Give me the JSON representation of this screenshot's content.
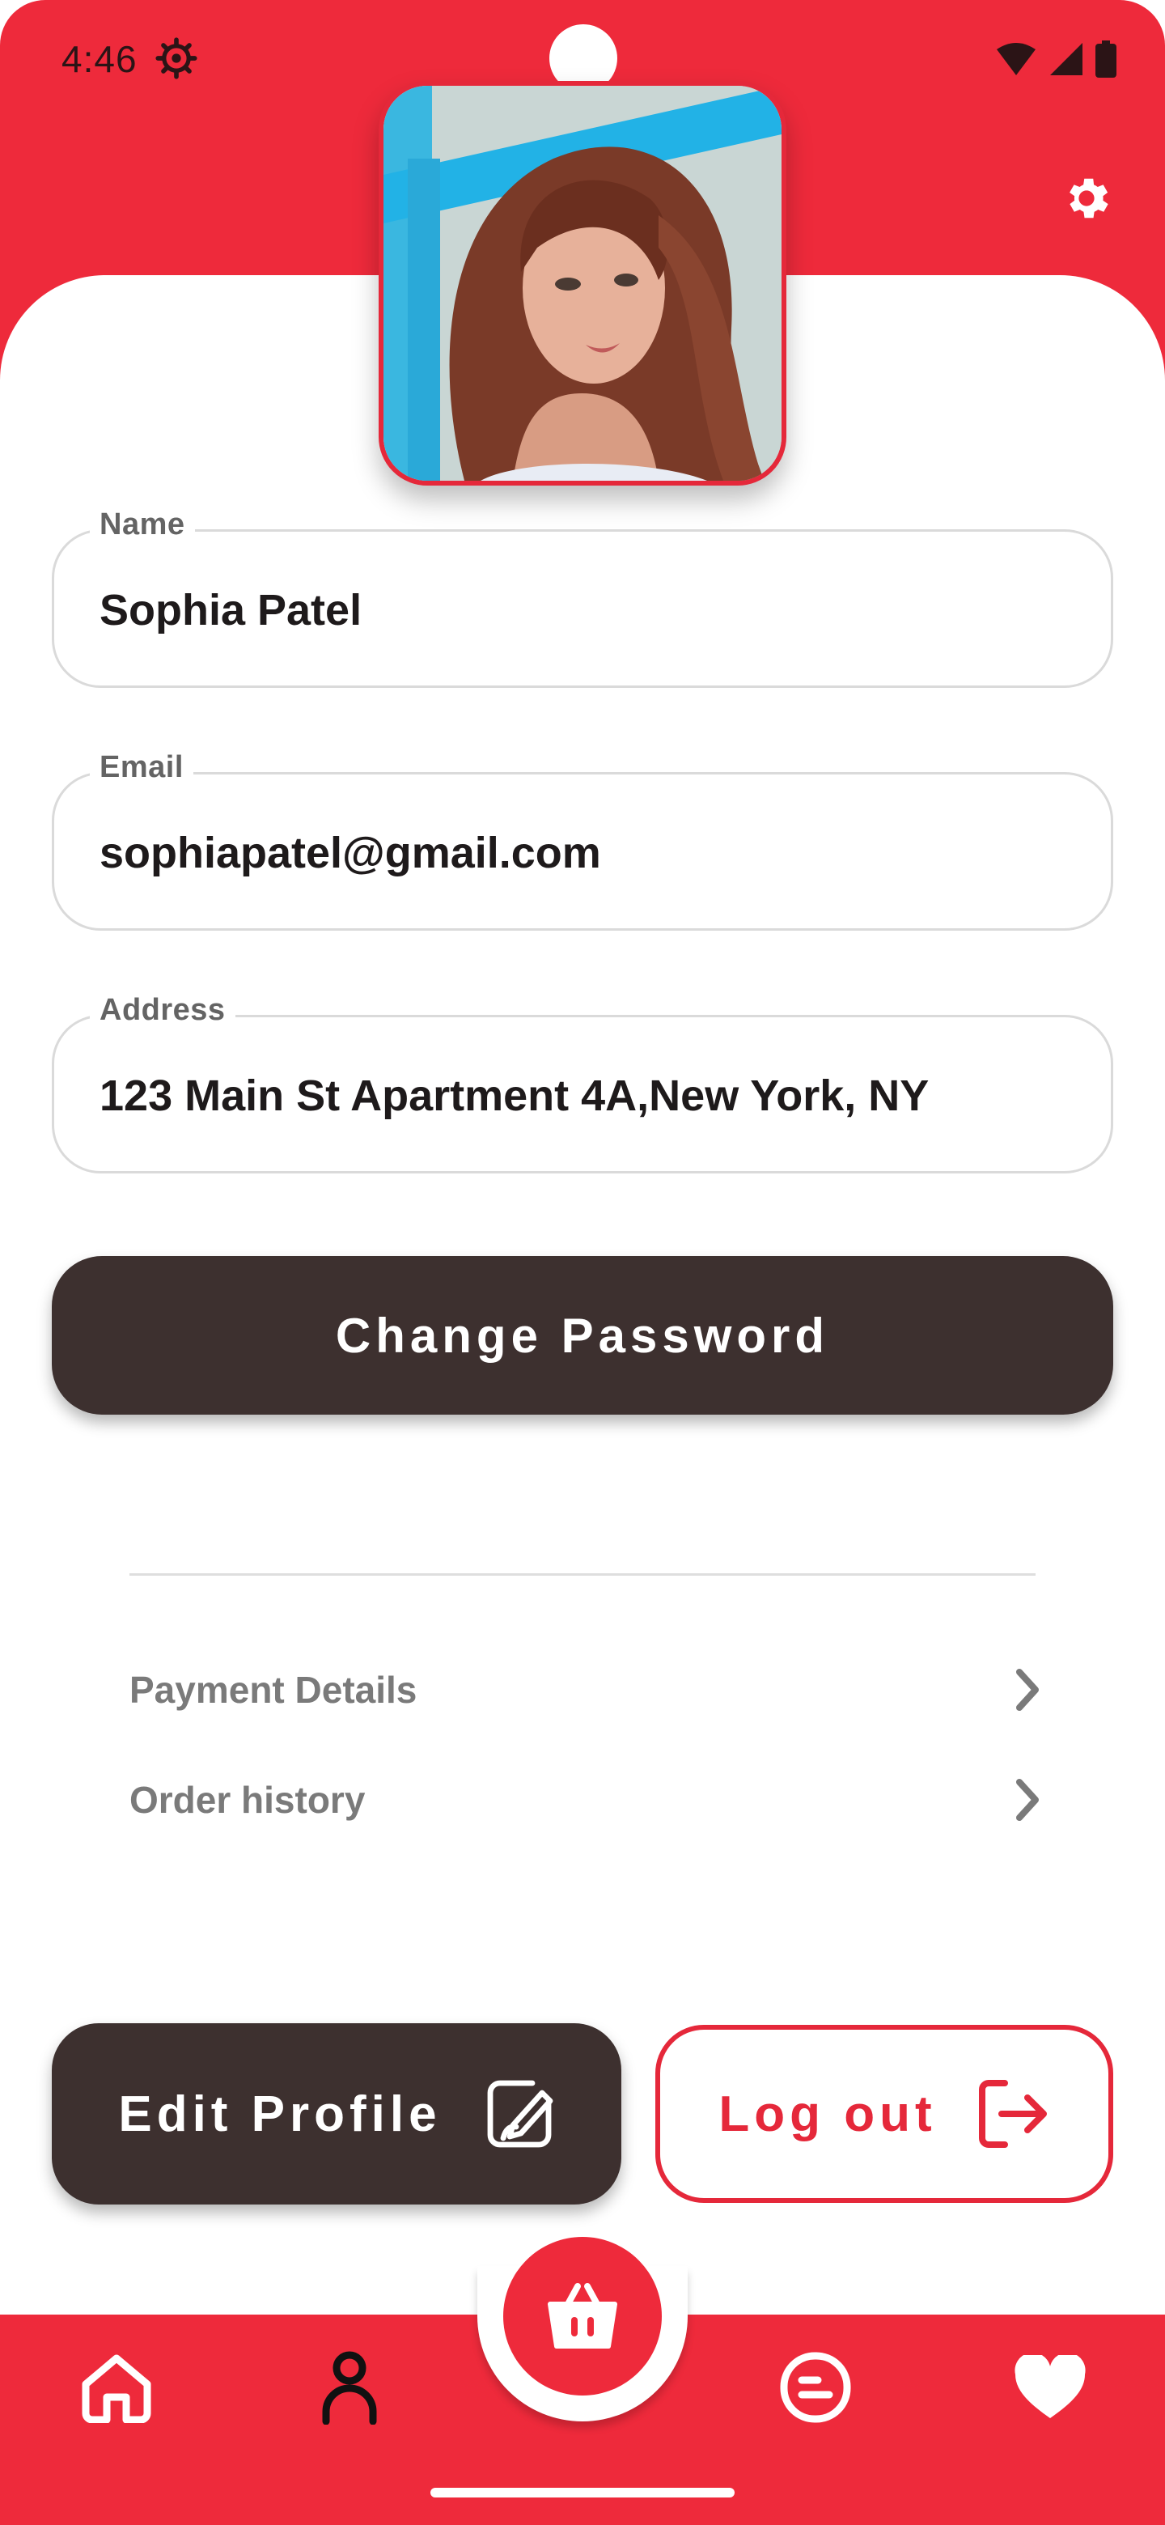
{
  "status_bar": {
    "time": "4:46"
  },
  "profile": {
    "fields": [
      {
        "label": "Name",
        "value": "Sophia Patel"
      },
      {
        "label": "Email",
        "value": "sophiapatel@gmail.com"
      },
      {
        "label": "Address",
        "value": "123 Main St Apartment 4A,New York, NY"
      }
    ],
    "change_password_label": "Change Password"
  },
  "menu": {
    "items": [
      {
        "label": "Payment Details",
        "icon": "chevron-right-icon"
      },
      {
        "label": "Order history",
        "icon": "chevron-right-icon"
      }
    ]
  },
  "actions": {
    "edit_profile_label": "Edit Profile",
    "logout_label": "Log out"
  },
  "bottom_nav": {
    "items": [
      "home-icon",
      "profile-icon",
      "cart-icon",
      "blog-icon",
      "heart-icon"
    ],
    "active": "profile-icon"
  },
  "colors": {
    "primary_red": "#ee2a3b",
    "dark_button": "#3d302f",
    "muted_text": "#7a7a7a",
    "border": "#dadada"
  }
}
